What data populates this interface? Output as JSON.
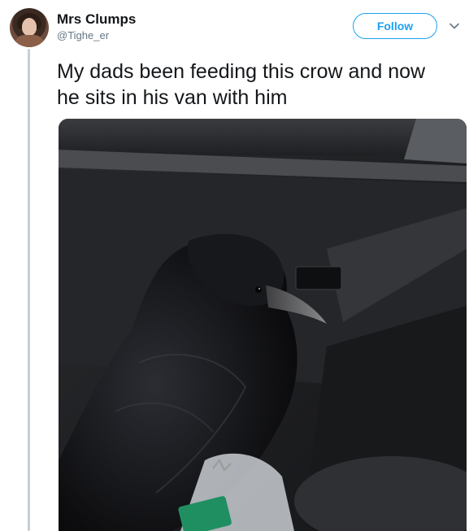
{
  "tweet": {
    "author_name": "Mrs Clumps",
    "author_handle": "@Tighe_er",
    "text": "My dads been feeding this crow and now he sits in his van with him",
    "follow_label": "Follow"
  },
  "icons": {
    "caret": "chevron-down-icon"
  },
  "colors": {
    "accent": "#1da1f2",
    "thread_line": "#c4cfd6",
    "text_primary": "#14171a",
    "text_secondary": "#657786"
  }
}
